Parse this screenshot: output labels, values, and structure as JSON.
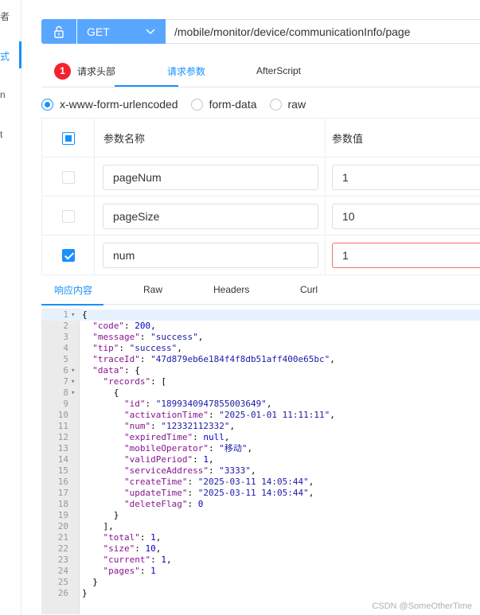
{
  "sidebar": {
    "fragments": [
      "者",
      "式",
      "n",
      "t"
    ]
  },
  "request": {
    "method": "GET",
    "url": "/mobile/monitor/device/communicationInfo/page",
    "lock_icon": "lock-icon",
    "chevron_icon": "chevron-down-icon"
  },
  "tabs": {
    "headers_label": "请求头部",
    "headers_badge": "1",
    "params_label": "请求参数",
    "afterscript_label": "AfterScript"
  },
  "body_type": {
    "options": [
      "x-www-form-urlencoded",
      "form-data",
      "raw"
    ],
    "selected": "x-www-form-urlencoded"
  },
  "params": {
    "header_name": "参数名称",
    "header_value": "参数值",
    "rows": [
      {
        "name": "pageNum",
        "value": "1",
        "checked": false
      },
      {
        "name": "pageSize",
        "value": "10",
        "checked": false
      },
      {
        "name": "num",
        "value": "1",
        "checked": true
      }
    ]
  },
  "response_tabs": {
    "content": "响应内容",
    "raw": "Raw",
    "headers": "Headers",
    "curl": "Curl"
  },
  "response_lines": [
    "{",
    "  \"code\": 200,",
    "  \"message\": \"success\",",
    "  \"tip\": \"success\",",
    "  \"traceId\": \"47d879eb6e184f4f8db51aff400e65bc\",",
    "  \"data\": {",
    "    \"records\": [",
    "      {",
    "        \"id\": \"1899340947855003649\",",
    "        \"activationTime\": \"2025-01-01 11:11:11\",",
    "        \"num\": \"12332112332\",",
    "        \"expiredTime\": null,",
    "        \"mobileOperator\": \"移动\",",
    "        \"validPeriod\": 1,",
    "        \"serviceAddress\": \"3333\",",
    "        \"createTime\": \"2025-03-11 14:05:44\",",
    "        \"updateTime\": \"2025-03-11 14:05:44\",",
    "        \"deleteFlag\": 0",
    "      }",
    "    ],",
    "    \"total\": 1,",
    "    \"size\": 10,",
    "    \"current\": 1,",
    "    \"pages\": 1",
    "  }",
    "}"
  ],
  "fold_lines": [
    1,
    6,
    7,
    8
  ],
  "watermark": "CSDN @SomeOtherTime",
  "colors": {
    "accent": "#1890ff",
    "method_bg": "#58a6ff",
    "badge": "#f5222d",
    "error_border": "#f56c6c"
  }
}
